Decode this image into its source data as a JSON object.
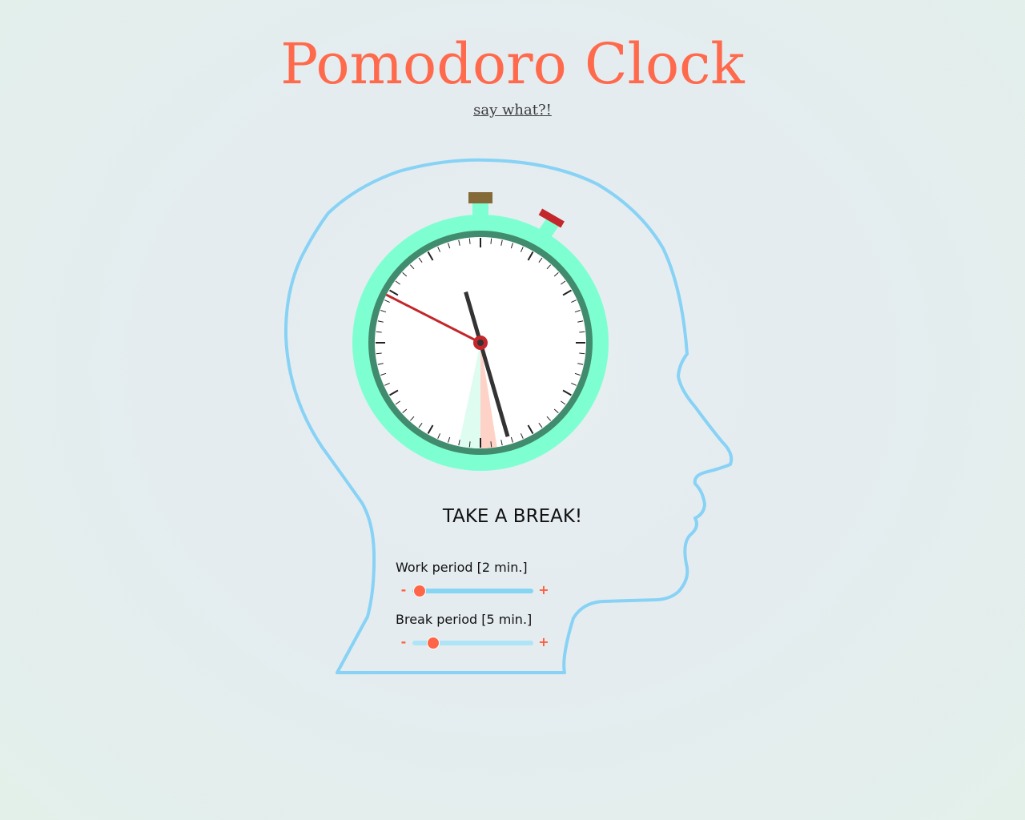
{
  "header": {
    "title": "Pomodoro Clock",
    "info_link": "say what?!"
  },
  "clock": {
    "minute_hand_minutes": 27.3,
    "second_hand_seconds": 49.5,
    "break_sector_minutes": [
      28.5,
      30
    ],
    "work_sector_minutes": [
      30,
      32
    ],
    "colors": {
      "head_outline": "#87d2f5",
      "bezel": "#7effd1",
      "ring": "#418b6e",
      "face": "#ffffff",
      "hand": "#333333",
      "second_hand": "#c3272b",
      "break_sector": "#ffd2c8",
      "work_sector": "#dffcf0",
      "top_button": "#846939",
      "side_button": "#c3272b"
    }
  },
  "status": {
    "text": "TAKE A BREAK!"
  },
  "settings": {
    "work": {
      "label": "Work period [2 min.]",
      "value": 2,
      "min": 1,
      "max": 60,
      "minus": "-",
      "plus": "+"
    },
    "break": {
      "label": "Break period [5 min.]",
      "value": 5,
      "min": 1,
      "max": 30,
      "minus": "-",
      "plus": "+"
    }
  }
}
